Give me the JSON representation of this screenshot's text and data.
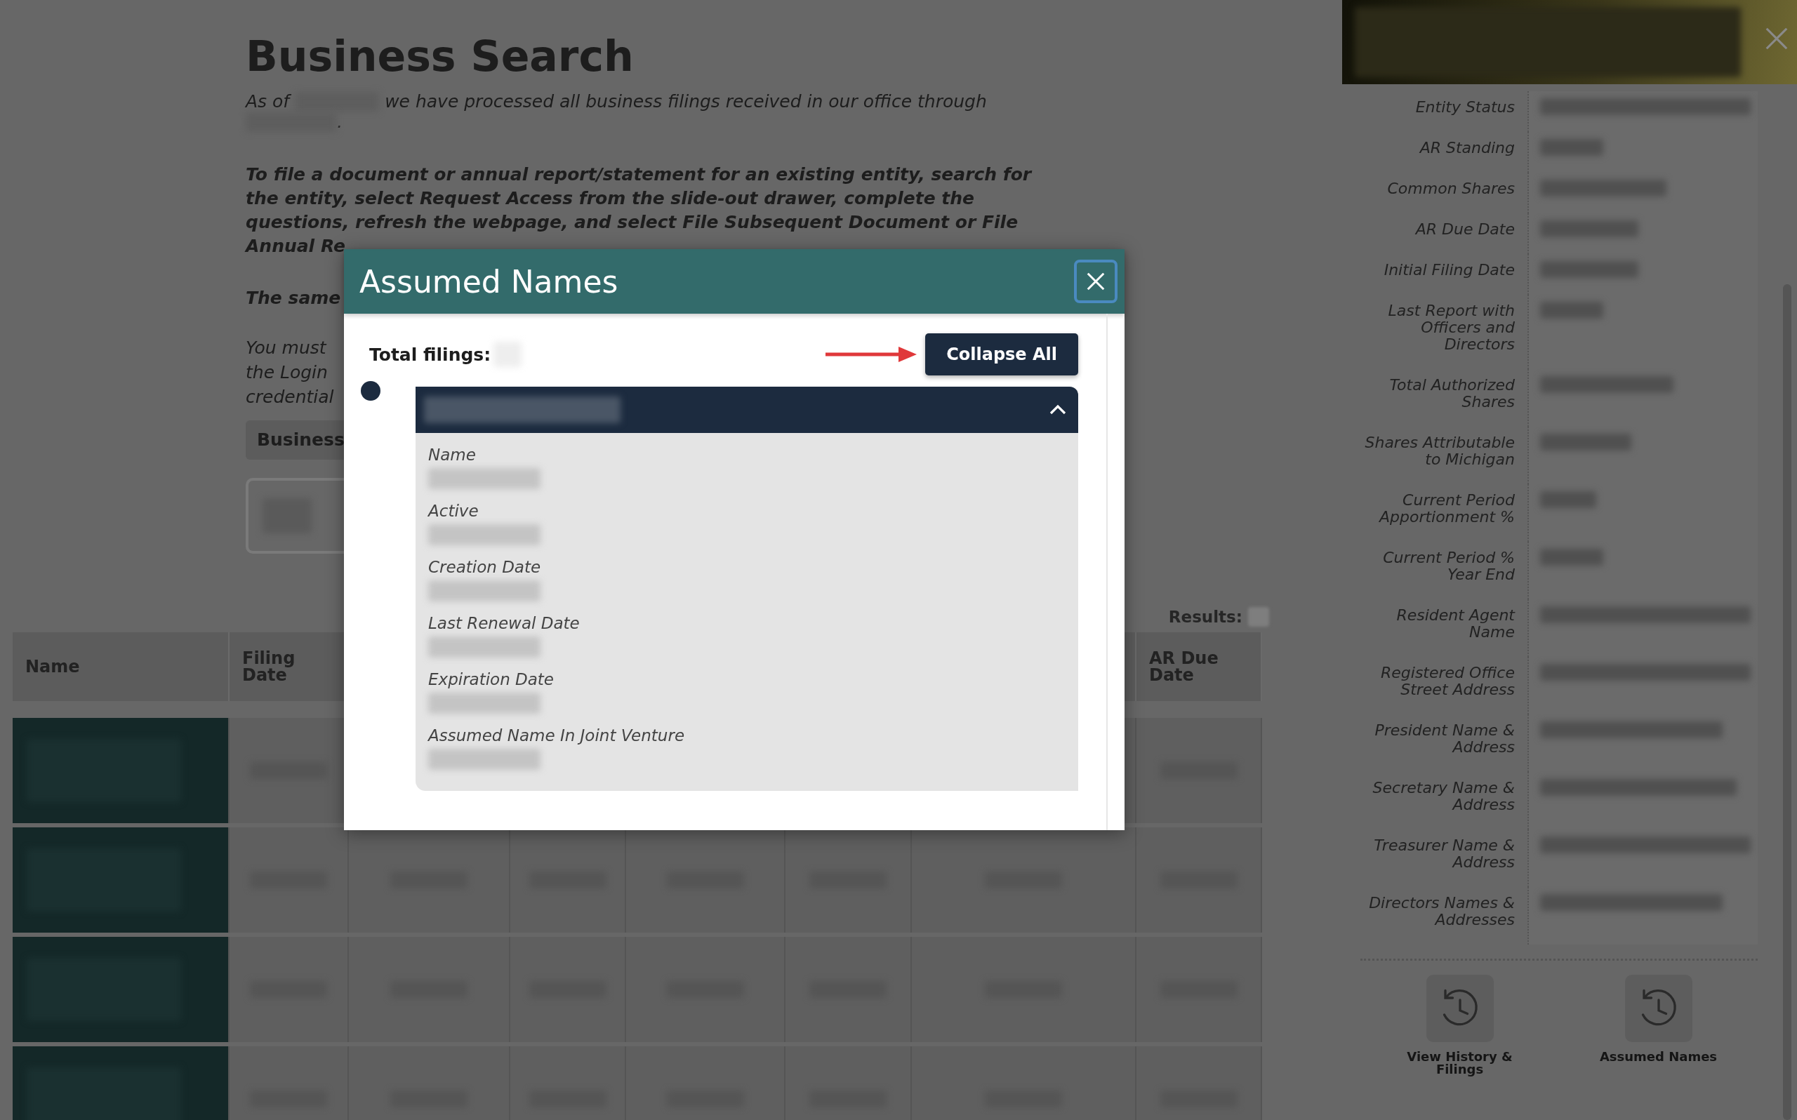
{
  "page": {
    "title": "Business Search",
    "as_of": {
      "before": "As of",
      "after": "we have processed all business filings received in our office through",
      "end": "."
    },
    "instruction_lines": [
      "To file a document or annual report/statement for an existing entity, search for",
      "the entity, select Request Access from the slide-out drawer, complete the",
      "questions, refresh the webpage, and select File Subsequent Document or File",
      "Annual Re"
    ],
    "same_line": "The same",
    "login_lines": [
      "You must",
      "the Login",
      "credential"
    ],
    "business_tab": "Business",
    "results_label": "Results:"
  },
  "table": {
    "columns": [
      {
        "label": "Name"
      },
      {
        "label": "Filing Date"
      },
      {
        "label": "AR Due Date"
      }
    ]
  },
  "drawer": {
    "fields": [
      "Entity Status",
      "AR Standing",
      "Common Shares",
      "AR Due Date",
      "Initial Filing Date",
      "Last Report with Officers and Directors",
      "Total Authorized Shares",
      "Shares Attributable to Michigan",
      "Current Period Apportionment %",
      "Current Period % Year End",
      "Resident Agent Name",
      "Registered Office Street Address",
      "President Name & Address",
      "Secretary Name & Address",
      "Treasurer Name & Address",
      "Directors Names & Addresses"
    ],
    "actions": [
      {
        "label": "View History & Filings"
      },
      {
        "label": "Assumed Names"
      }
    ]
  },
  "modal": {
    "title": "Assumed Names",
    "total_label": "Total filings:",
    "collapse_button": "Collapse All",
    "entries": [
      {
        "expanded": true,
        "fields": [
          "Name",
          "Active",
          "Creation Date",
          "Last Renewal Date",
          "Expiration Date",
          "Assumed Name In Joint Venture"
        ]
      }
    ]
  }
}
